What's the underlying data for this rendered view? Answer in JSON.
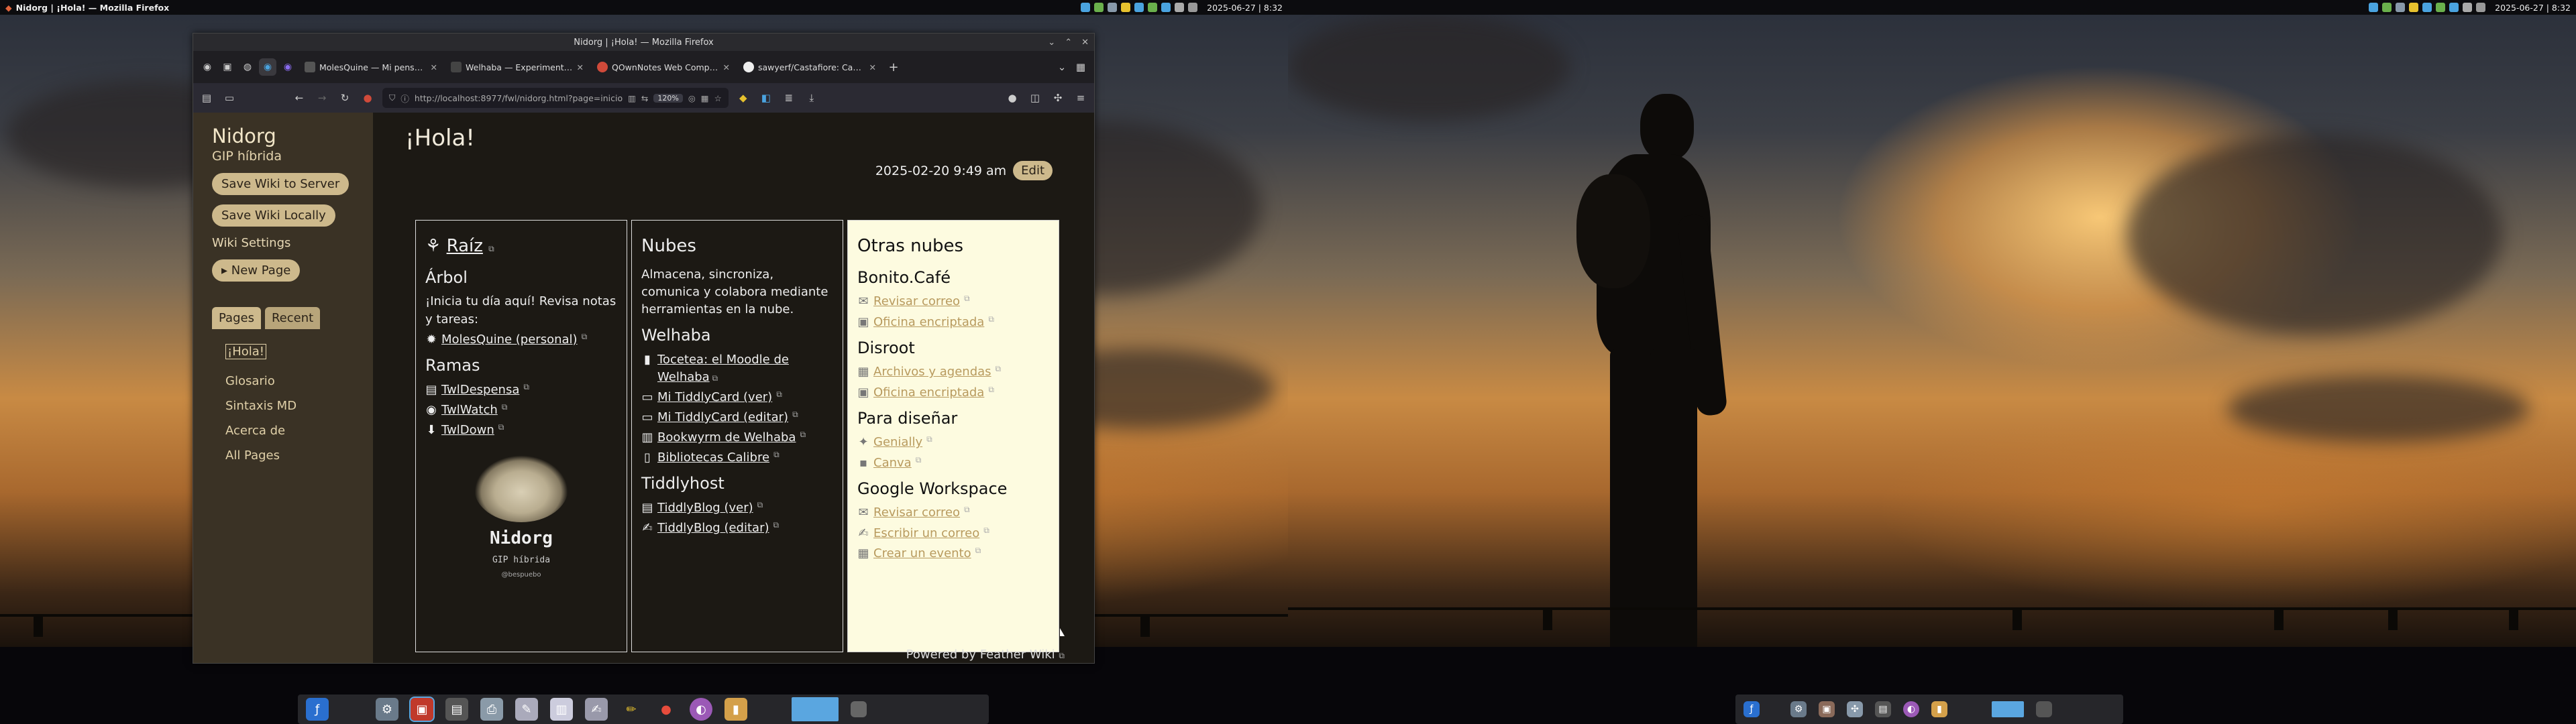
{
  "left_panel": {
    "title": "Nidorg | ¡Hola! — Mozilla Firefox",
    "clock": "2025-06-27 | 8:32",
    "tray_icons": [
      "network-icon",
      "bluetooth-icon",
      "volume-icon",
      "battery-icon",
      "clipboard-icon",
      "updates-icon",
      "display-icon",
      "keyboard-icon",
      "power-icon"
    ]
  },
  "right_panel": {
    "clock": "2025-06-27 | 8:32"
  },
  "firefox": {
    "window_title": "Nidorg | ¡Hola! — Mozilla Firefox",
    "tabs": [
      {
        "label": "MolesQuine — Mi pensadero",
        "color": "#555"
      },
      {
        "label": "Welhaba — Experimenta la lectura",
        "color": "#444"
      },
      {
        "label": "QOwnNotes Web Companion",
        "color": "#d04a3a"
      },
      {
        "label": "sawyerf/Castafiore: Castafiore",
        "color": "#eee"
      }
    ],
    "url": "http://localhost:8977/fwl/nidorg.html?page=inicio",
    "zoom": "120%"
  },
  "wiki": {
    "name": "Nidorg",
    "description": "GIP híbrida",
    "save_server": "Save Wiki to Server",
    "save_local": "Save Wiki Locally",
    "settings": "Wiki Settings",
    "new_page": "▸ New Page",
    "tab_pages": "Pages",
    "tab_recent": "Recent",
    "pages": [
      "¡Hola!",
      "Glosario",
      "Sintaxis MD",
      "Acerca de",
      "All Pages"
    ],
    "page_title": "¡Hola!",
    "datetime": "2025-02-20 9:49 am",
    "edit": "Edit",
    "powered_by": "Powered by Feather Wiki",
    "col1": {
      "heading": "Raíz",
      "sub1": "Árbol",
      "intro": "¡Inicia tu día aquí! Revisa notas y tareas:",
      "link1": "MolesQuine (personal)",
      "sub2": "Ramas",
      "ramas": [
        "TwlDespensa",
        "TwlWatch",
        "TwlDown"
      ],
      "logo_name": "Nidorg",
      "logo_sub": "GIP híbrida",
      "logo_tiny": "@bespuebo"
    },
    "col2": {
      "heading": "Nubes",
      "intro": "Almacena, sincroniza, comunica y colabora mediante herramientas en la nube.",
      "sub1": "Welhaba",
      "welhaba": [
        "Tocetea: el Moodle de Welhaba",
        "Mi TiddlyCard (ver)",
        "Mi TiddlyCard (editar)",
        "Bookwyrm de Welhaba",
        "Bibliotecas Calibre"
      ],
      "sub2": "Tiddlyhost",
      "tiddlyhost": [
        "TiddlyBlog (ver)",
        "TiddlyBlog (editar)"
      ]
    },
    "col3": {
      "heading": "Otras nubes",
      "groups": [
        {
          "name": "Bonito.Café",
          "items": [
            "Revisar correo",
            "Oficina encriptada"
          ]
        },
        {
          "name": "Disroot",
          "items": [
            "Archivos y agendas",
            "Oficina encriptada"
          ]
        },
        {
          "name": "Para diseñar",
          "items": [
            "Genially",
            "Canva"
          ]
        },
        {
          "name": "Google Workspace",
          "items": [
            "Revisar correo",
            "Escribir un correo",
            "Crear un evento"
          ]
        }
      ]
    }
  }
}
